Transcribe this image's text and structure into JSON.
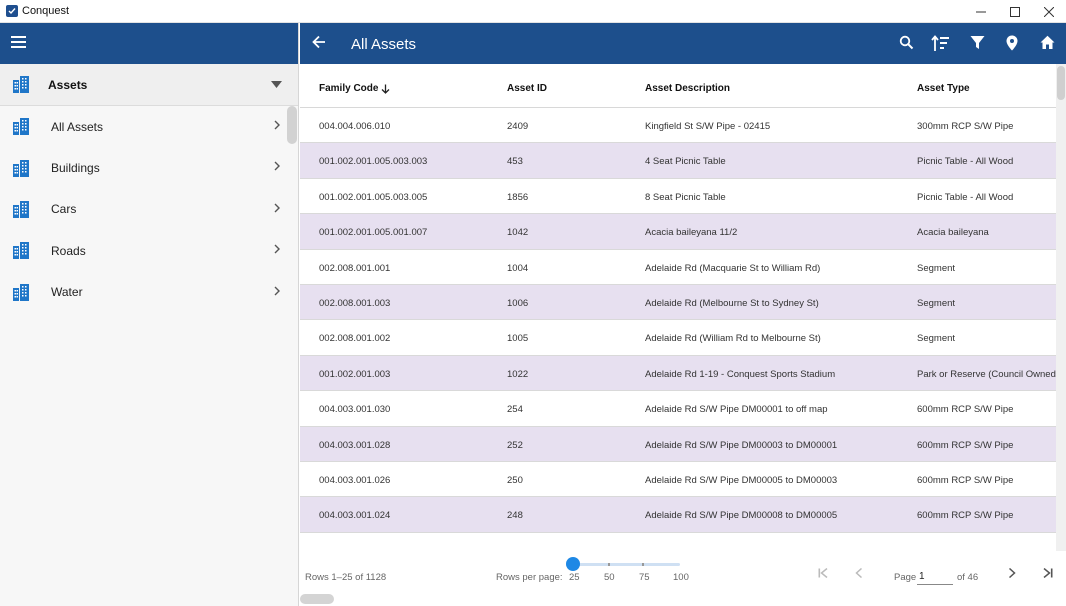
{
  "window": {
    "title": "Conquest",
    "controls": [
      "minimize",
      "maximize",
      "close"
    ]
  },
  "colors": {
    "header": "#1d4f8c",
    "accent": "#1e88e5",
    "row_alt": "#e7e0f0",
    "icon": "#1f76c8"
  },
  "sidebar": {
    "menu_icon": "hamburger-icon",
    "group": {
      "label": "Assets",
      "icon": "building-icon"
    },
    "items": [
      {
        "label": "All Assets",
        "icon": "building-icon"
      },
      {
        "label": "Buildings",
        "icon": "building-icon"
      },
      {
        "label": "Cars",
        "icon": "building-icon"
      },
      {
        "label": "Roads",
        "icon": "building-icon"
      },
      {
        "label": "Water",
        "icon": "building-icon"
      }
    ]
  },
  "main": {
    "title": "All Assets",
    "toolbar_icons": [
      "search-icon",
      "sort-icon",
      "filter-icon",
      "map-pin-icon",
      "home-icon"
    ],
    "columns": [
      "Family Code",
      "Asset ID",
      "Asset Description",
      "Asset Type"
    ],
    "sort": {
      "column": "Family Code",
      "direction": "descending"
    },
    "rows": [
      {
        "family_code": "004.004.006.010",
        "asset_id": "2409",
        "description": "Kingfield St S/W Pipe - 02415",
        "type": "300mm RCP S/W Pipe"
      },
      {
        "family_code": "001.002.001.005.003.003",
        "asset_id": "453",
        "description": "4 Seat Picnic Table",
        "type": "Picnic Table - All Wood"
      },
      {
        "family_code": "001.002.001.005.003.005",
        "asset_id": "1856",
        "description": "8 Seat Picnic Table",
        "type": "Picnic Table - All Wood"
      },
      {
        "family_code": "001.002.001.005.001.007",
        "asset_id": "1042",
        "description": "Acacia baileyana 11/2",
        "type": "Acacia baileyana"
      },
      {
        "family_code": "002.008.001.001",
        "asset_id": "1004",
        "description": "Adelaide Rd (Macquarie St to William Rd)",
        "type": "Segment"
      },
      {
        "family_code": "002.008.001.003",
        "asset_id": "1006",
        "description": "Adelaide Rd (Melbourne St to Sydney St)",
        "type": "Segment"
      },
      {
        "family_code": "002.008.001.002",
        "asset_id": "1005",
        "description": "Adelaide Rd (William Rd to Melbourne St)",
        "type": "Segment"
      },
      {
        "family_code": "001.002.001.003",
        "asset_id": "1022",
        "description": "Adelaide Rd 1-19 - Conquest Sports Stadium",
        "type": "Park or Reserve (Council Owned)"
      },
      {
        "family_code": "004.003.001.030",
        "asset_id": "254",
        "description": "Adelaide Rd S/W Pipe DM00001 to off map",
        "type": "600mm RCP S/W Pipe"
      },
      {
        "family_code": "004.003.001.028",
        "asset_id": "252",
        "description": "Adelaide Rd S/W Pipe DM00003 to DM00001",
        "type": "600mm RCP S/W Pipe"
      },
      {
        "family_code": "004.003.001.026",
        "asset_id": "250",
        "description": "Adelaide Rd S/W Pipe DM00005 to DM00003",
        "type": "600mm RCP S/W Pipe"
      },
      {
        "family_code": "004.003.001.024",
        "asset_id": "248",
        "description": "Adelaide Rd S/W Pipe DM00008 to DM00005",
        "type": "600mm RCP S/W Pipe"
      }
    ]
  },
  "pager": {
    "rows_info": "Rows 1–25 of 1128",
    "rows_per_page_label": "Rows per page:",
    "rows_per_page_options": [
      "25",
      "50",
      "75",
      "100"
    ],
    "rows_per_page_selected": "25",
    "page_label": "Page",
    "page_value": "1",
    "page_of": "of 46"
  }
}
